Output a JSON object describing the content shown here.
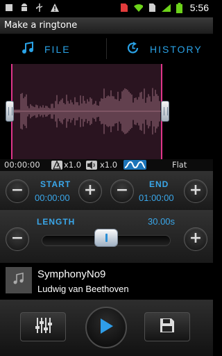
{
  "status_bar": {
    "time": "5:56",
    "icons": [
      "square-notification-icon",
      "android-icon",
      "usb-icon",
      "warning-icon",
      "sim-icon",
      "wifi-icon",
      "sd-card-icon",
      "signal-icon",
      "battery-icon"
    ]
  },
  "app": {
    "title": "Make a ringtone"
  },
  "tabs": {
    "file": "FILE",
    "history": "HISTORY"
  },
  "info_strip": {
    "position": "00:00:00",
    "speed1": "x1.0",
    "speed2": "x1.0",
    "eq_preset": "Flat"
  },
  "start": {
    "label": "START",
    "value": "00:00:00"
  },
  "end": {
    "label": "END",
    "value": "01:00:00"
  },
  "length": {
    "label": "LENGTH",
    "value": "30.00s",
    "fraction": 0.5
  },
  "track": {
    "title": "SymphonyNo9",
    "artist": "Ludwig van Beethoven"
  },
  "colors": {
    "accent": "#3aa7ea",
    "selection": "#e0358a",
    "waveform": "#7a5463"
  }
}
